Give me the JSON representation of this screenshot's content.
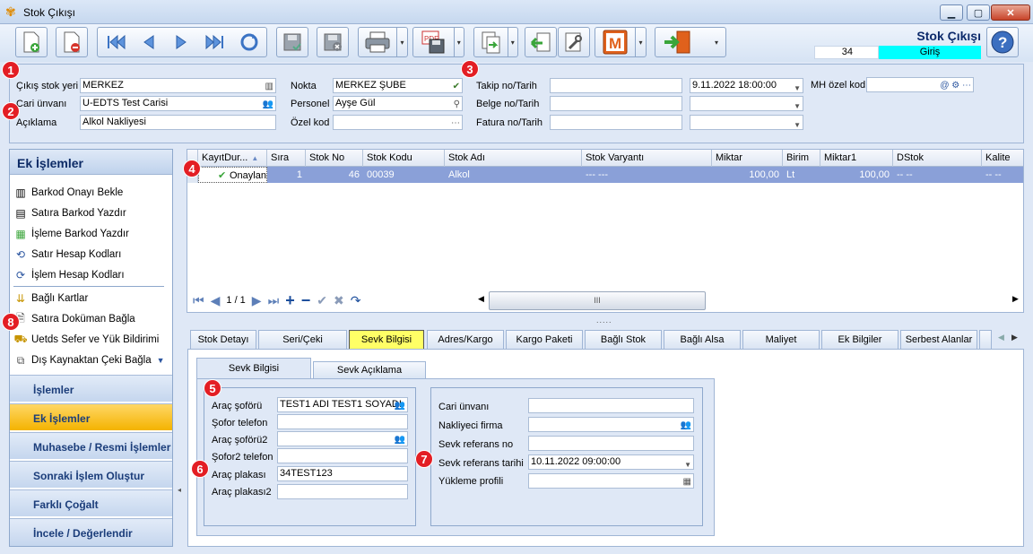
{
  "window": {
    "title": "Stok Çıkışı",
    "minimize": "▁",
    "maximize": "▢",
    "close": "✕"
  },
  "header_info": {
    "doc_title": "Stok Çıkışı",
    "doc_number": "34",
    "direction": "Giriş"
  },
  "badges": [
    "1",
    "2",
    "3",
    "4",
    "5",
    "6",
    "7",
    "8"
  ],
  "form": {
    "stok_yeri": {
      "label": "Çıkış stok yeri",
      "value": "MERKEZ"
    },
    "cari_unvani": {
      "label": "Cari ünvanı",
      "value": "U-EDTS Test Carisi"
    },
    "aciklama": {
      "label": "Açıklama",
      "value": "Alkol Nakliyesi"
    },
    "nokta": {
      "label": "Nokta",
      "value": "MERKEZ ŞUBE"
    },
    "personel": {
      "label": "Personel",
      "value": "Ayşe Gül"
    },
    "ozel_kod": {
      "label": "Özel kod",
      "value": ""
    },
    "takip": {
      "label": "Takip no/Tarih",
      "value": "",
      "date": "9.11.2022 18:00:00"
    },
    "belge": {
      "label": "Belge no/Tarih",
      "value": "",
      "date": ""
    },
    "fatura": {
      "label": "Fatura no/Tarih",
      "value": "",
      "date": ""
    },
    "mh_ozel_kod": {
      "label": "MH özel kod",
      "value": ""
    }
  },
  "left_panel": {
    "title": "Ek İşlemler",
    "items": [
      {
        "label": "Barkod Onayı Bekle",
        "icon": "barcode-icon"
      },
      {
        "label": "Satıra Barkod Yazdır",
        "icon": "barcode-print-icon"
      },
      {
        "label": "İşleme Barkod Yazdır",
        "icon": "barcode-print-icon"
      },
      {
        "label": "Satır Hesap Kodları",
        "icon": "account-code-icon"
      },
      {
        "label": "İşlem Hesap Kodları",
        "icon": "account-code-icon"
      },
      {
        "label": "Bağlı Kartlar",
        "icon": "linked-cards-icon"
      },
      {
        "label": "Satıra Doküman Bağla",
        "icon": "document-link-icon"
      },
      {
        "label": "Uetds Sefer ve Yük Bildirimi",
        "icon": "uetds-icon"
      },
      {
        "label": "Dış Kaynaktan Çeki Bağla",
        "icon": "external-link-icon"
      }
    ],
    "nav": [
      "İşlemler",
      "Ek İşlemler",
      "Muhasebe / Resmi İşlemler",
      "Sonraki İşlem Oluştur",
      "Farklı Çoğalt",
      "İncele / Değerlendir"
    ]
  },
  "grid": {
    "columns": [
      "KayıtDur...",
      "Sıra",
      "Stok No",
      "Stok Kodu",
      "Stok Adı",
      "Stok Varyantı",
      "Miktar",
      "Birim",
      "Miktar1",
      "DStok",
      "Kalite"
    ],
    "row": {
      "status": "Onaylandı",
      "sira": "1",
      "stok_no": "46",
      "stok_kodu": "00039",
      "stok_adi": "Alkol",
      "varyant": "--- ---",
      "miktar": "100,00",
      "birim": "Lt",
      "miktar1": "100,00",
      "dstok": "-- --",
      "kalite": "-- --"
    },
    "pager": "1 / 1",
    "scroll_thumb": "III"
  },
  "tabs": [
    "Stok Detayı",
    "Seri/Çeki",
    "Sevk Bilgisi",
    "Adres/Kargo",
    "Kargo Paketi",
    "Bağlı Stok",
    "Bağlı Alsa",
    "Maliyet",
    "Ek Bilgiler",
    "Serbest Alanlar"
  ],
  "subtabs": [
    "Sevk Bilgisi",
    "Sevk Açıklama"
  ],
  "sevk_left": [
    {
      "label": "Araç şoförü",
      "value": "TEST1 ADI TEST1 SOYADI"
    },
    {
      "label": "Şofor telefon",
      "value": ""
    },
    {
      "label": "Araç şoförü2",
      "value": ""
    },
    {
      "label": "Şofor2 telefon",
      "value": ""
    },
    {
      "label": "Araç plakası",
      "value": "34TEST123"
    },
    {
      "label": "Araç plakası2",
      "value": ""
    }
  ],
  "sevk_right": [
    {
      "label": "Cari ünvanı",
      "value": ""
    },
    {
      "label": "Nakliyeci firma",
      "value": ""
    },
    {
      "label": "Sevk referans no",
      "value": ""
    },
    {
      "label": "Sevk referans tarihi",
      "value": "10.11.2022 09:00:00"
    },
    {
      "label": "Yükleme profili",
      "value": ""
    }
  ],
  "colors": {
    "accent": "#0c2a6b",
    "badge": "#e31e24",
    "selected_row": "#8aa0d8",
    "active_nav": "#f4b300",
    "selected_tab": "#ffff66",
    "direction_bg": "#00ffff"
  }
}
